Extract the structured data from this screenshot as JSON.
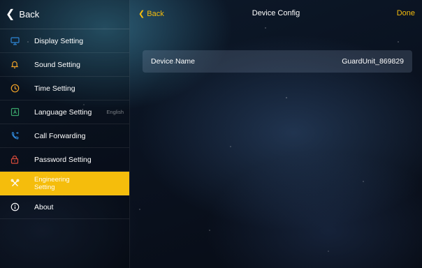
{
  "sidebar": {
    "back_label": "Back",
    "items": [
      {
        "label": "Display Setting",
        "icon": "monitor-icon",
        "sub": ""
      },
      {
        "label": "Sound Setting",
        "icon": "bell-icon",
        "sub": ""
      },
      {
        "label": "Time Setting",
        "icon": "clock-icon",
        "sub": ""
      },
      {
        "label": "Language Setting",
        "icon": "language-icon",
        "sub": "English"
      },
      {
        "label": "Call Forwarding",
        "icon": "phone-forward-icon",
        "sub": ""
      },
      {
        "label": "Password Setting",
        "icon": "lock-icon",
        "sub": ""
      },
      {
        "label_line1": "Engineering",
        "label_line2": "Setting",
        "icon": "tools-icon",
        "active": true
      },
      {
        "label": "About",
        "icon": "info-icon",
        "sub": ""
      }
    ]
  },
  "topbar": {
    "back_label": "Back",
    "title": "Device Config",
    "done_label": "Done"
  },
  "device_name": {
    "label": "Device Name",
    "value": "GuardUnit_869829"
  },
  "colors": {
    "accent": "#f5bd0c",
    "blue_icon": "#2f86d6",
    "green_icon": "#3aa56a",
    "red_icon": "#d94b3b",
    "orange_icon": "#f2a428"
  }
}
